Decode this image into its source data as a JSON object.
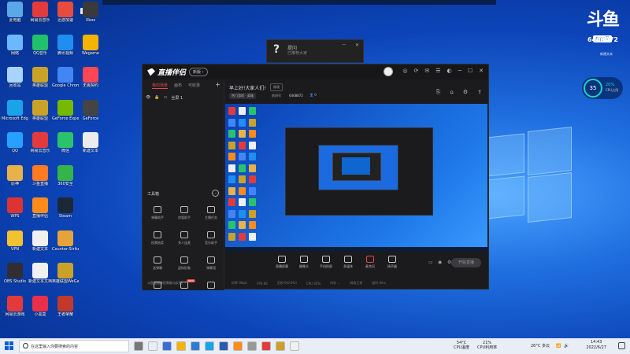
{
  "desktop": {
    "icons": [
      {
        "label": "此电脑",
        "color": "#5aa9e6",
        "col": 0,
        "row": 0
      },
      {
        "label": "网易云音乐",
        "color": "#e33b3b",
        "col": 1,
        "row": 0
      },
      {
        "label": "迅游加速",
        "color": "#e74c3c",
        "col": 2,
        "row": 0
      },
      {
        "label": "网络",
        "color": "#6bb8ff",
        "col": 0,
        "row": 1
      },
      {
        "label": "QQ音乐",
        "color": "#21c06a",
        "col": 1,
        "row": 1
      },
      {
        "label": "腾讯视频",
        "color": "#1f8ef1",
        "col": 2,
        "row": 1
      },
      {
        "label": "回收站",
        "color": "#a9d3ff",
        "col": 0,
        "row": 2
      },
      {
        "label": "英雄联盟",
        "color": "#c9a227",
        "col": 1,
        "row": 2
      },
      {
        "label": "Google Chrome",
        "color": "#4285f4",
        "col": 2,
        "row": 2
      },
      {
        "label": "Microsoft Edge",
        "color": "#1aa3e8",
        "col": 0,
        "row": 3
      },
      {
        "label": "英雄联盟",
        "color": "#c9a227",
        "col": 1,
        "row": 3
      },
      {
        "label": "GeForce Experience",
        "color": "#76b900",
        "col": 2,
        "row": 3
      },
      {
        "label": "QQ",
        "color": "#27a0ff",
        "col": 0,
        "row": 4
      },
      {
        "label": "网易云音乐",
        "color": "#e33b3b",
        "col": 1,
        "row": 4
      },
      {
        "label": "微信",
        "color": "#2ac36b",
        "col": 2,
        "row": 4
      },
      {
        "label": "原神",
        "color": "#e8b24a",
        "col": 0,
        "row": 5
      },
      {
        "label": "斗鱼直播",
        "color": "#ff7a21",
        "col": 1,
        "row": 5
      },
      {
        "label": "360安全",
        "color": "#35b44a",
        "col": 2,
        "row": 5
      },
      {
        "label": "WPS",
        "color": "#d33",
        "col": 0,
        "row": 6
      },
      {
        "label": "直播伴侣",
        "color": "#ff8c1a",
        "col": 1,
        "row": 6
      },
      {
        "label": "Steam",
        "color": "#1b2838",
        "col": 2,
        "row": 6
      },
      {
        "label": "VPN",
        "color": "#f2c230",
        "col": 0,
        "row": 7
      },
      {
        "label": "新建文本",
        "color": "#f0f0f0",
        "col": 1,
        "row": 7
      },
      {
        "label": "Counter-Strike",
        "color": "#e5a33a",
        "col": 2,
        "row": 7
      },
      {
        "label": "OBS Studio",
        "color": "#302e31",
        "col": 0,
        "row": 8
      },
      {
        "label": "新建文本文档",
        "color": "#f0f0f0",
        "col": 1,
        "row": 8
      },
      {
        "label": "英雄联盟WeGame",
        "color": "#c9a227",
        "col": 2,
        "row": 8
      },
      {
        "label": "网易云游戏",
        "color": "#e33b3b",
        "col": 0,
        "row": 9
      },
      {
        "label": "小黑盒",
        "color": "#e8304b",
        "col": 1,
        "row": 9
      },
      {
        "label": "王者荣耀",
        "color": "#c0392b",
        "col": 2,
        "row": 9
      }
    ],
    "extra_icons": [
      {
        "label": "Xbox",
        "color": "#3a3a3a",
        "col": 3,
        "row": 0
      },
      {
        "label": "Wegame",
        "color": "#f4b400",
        "col": 3,
        "row": 1
      },
      {
        "label": "无畏契约",
        "color": "#ff4655",
        "col": 3,
        "row": 2
      },
      {
        "label": "GeForce",
        "color": "#444",
        "col": 3,
        "row": 3
      },
      {
        "label": "新建文本",
        "color": "#ececec",
        "col": 3,
        "row": 4
      }
    ]
  },
  "popup": {
    "title": "提问",
    "subtitle": "已推荐大家"
  },
  "app": {
    "name": "直播伴侣",
    "version_badge": "新版 ›",
    "left_tabs": [
      "我的场景",
      "画布",
      "可收录"
    ],
    "scene_name": "全屏 1",
    "tools_title": "工具箱",
    "tools": [
      {
        "label": "弹幕助手",
        "hot": ""
      },
      {
        "label": "房管助手",
        "hot": ""
      },
      {
        "label": "主播任务",
        "hot": ""
      },
      {
        "label": "投票抽奖",
        "hot": ""
      },
      {
        "label": "多人连麦",
        "hot": ""
      },
      {
        "label": "音乐助手",
        "hot": ""
      },
      {
        "label": "送弹幕",
        "hot": ""
      },
      {
        "label": "虚拟形象",
        "hot": ""
      },
      {
        "label": "弹幕墙",
        "hot": ""
      },
      {
        "label": "",
        "hot": ""
      },
      {
        "label": "",
        "hot": "NEW"
      },
      {
        "label": "",
        "hot": ""
      }
    ],
    "left_footer": "斗鱼直播伴侣帮助与反馈",
    "stream_title": "早上好!大家人们!",
    "edit_label": "修改",
    "category": "热门游戏 · 英雄",
    "room_label": "房间号",
    "room_number": "6468872",
    "viewer_count": "0",
    "controls": [
      {
        "label": "直播屏幕",
        "name": "screen-capture-button"
      },
      {
        "label": "摄像头",
        "name": "camera-button"
      },
      {
        "label": "手机投屏",
        "name": "phone-cast-button"
      },
      {
        "label": "多媒体",
        "name": "media-button"
      },
      {
        "label": "麦克风",
        "name": "microphone-button"
      },
      {
        "label": "扬声器",
        "name": "speaker-button"
      }
    ],
    "start_label": "开始直播",
    "stats": [
      "码率 0kb/s",
      "FPS 60",
      "丢帧 0(0.0%)",
      "CPU 35%",
      "内存 ...",
      "网络正常",
      "延时 0ms"
    ]
  },
  "widgets": {
    "brand_main": "斗鱼",
    "brand_sub": "房间号",
    "brand_number": "6468872",
    "brand_caption": "新建文本",
    "cpu_percent": "35",
    "cpu_sub_percent": "20%",
    "cpu_label": "CPU占用"
  },
  "taskbar": {
    "search_placeholder": "在这里输入你要搜索的内容",
    "weather": "26°C 多云",
    "cpu_temp": "54°C",
    "cpu_temp_label": "CPU温度",
    "cpu_usage": "21%",
    "cpu_usage_label": "CPU利用率",
    "time": "14:43",
    "date": "2022/6/27",
    "apps": [
      "#777",
      "#e9eef6",
      "#3a6fd8",
      "#f4b400",
      "#2e7bd6",
      "#1aa3e8",
      "#2a5db0",
      "#ff8c1a",
      "#999",
      "#e33b3b",
      "#c9a227",
      "#f0f0f0"
    ]
  }
}
